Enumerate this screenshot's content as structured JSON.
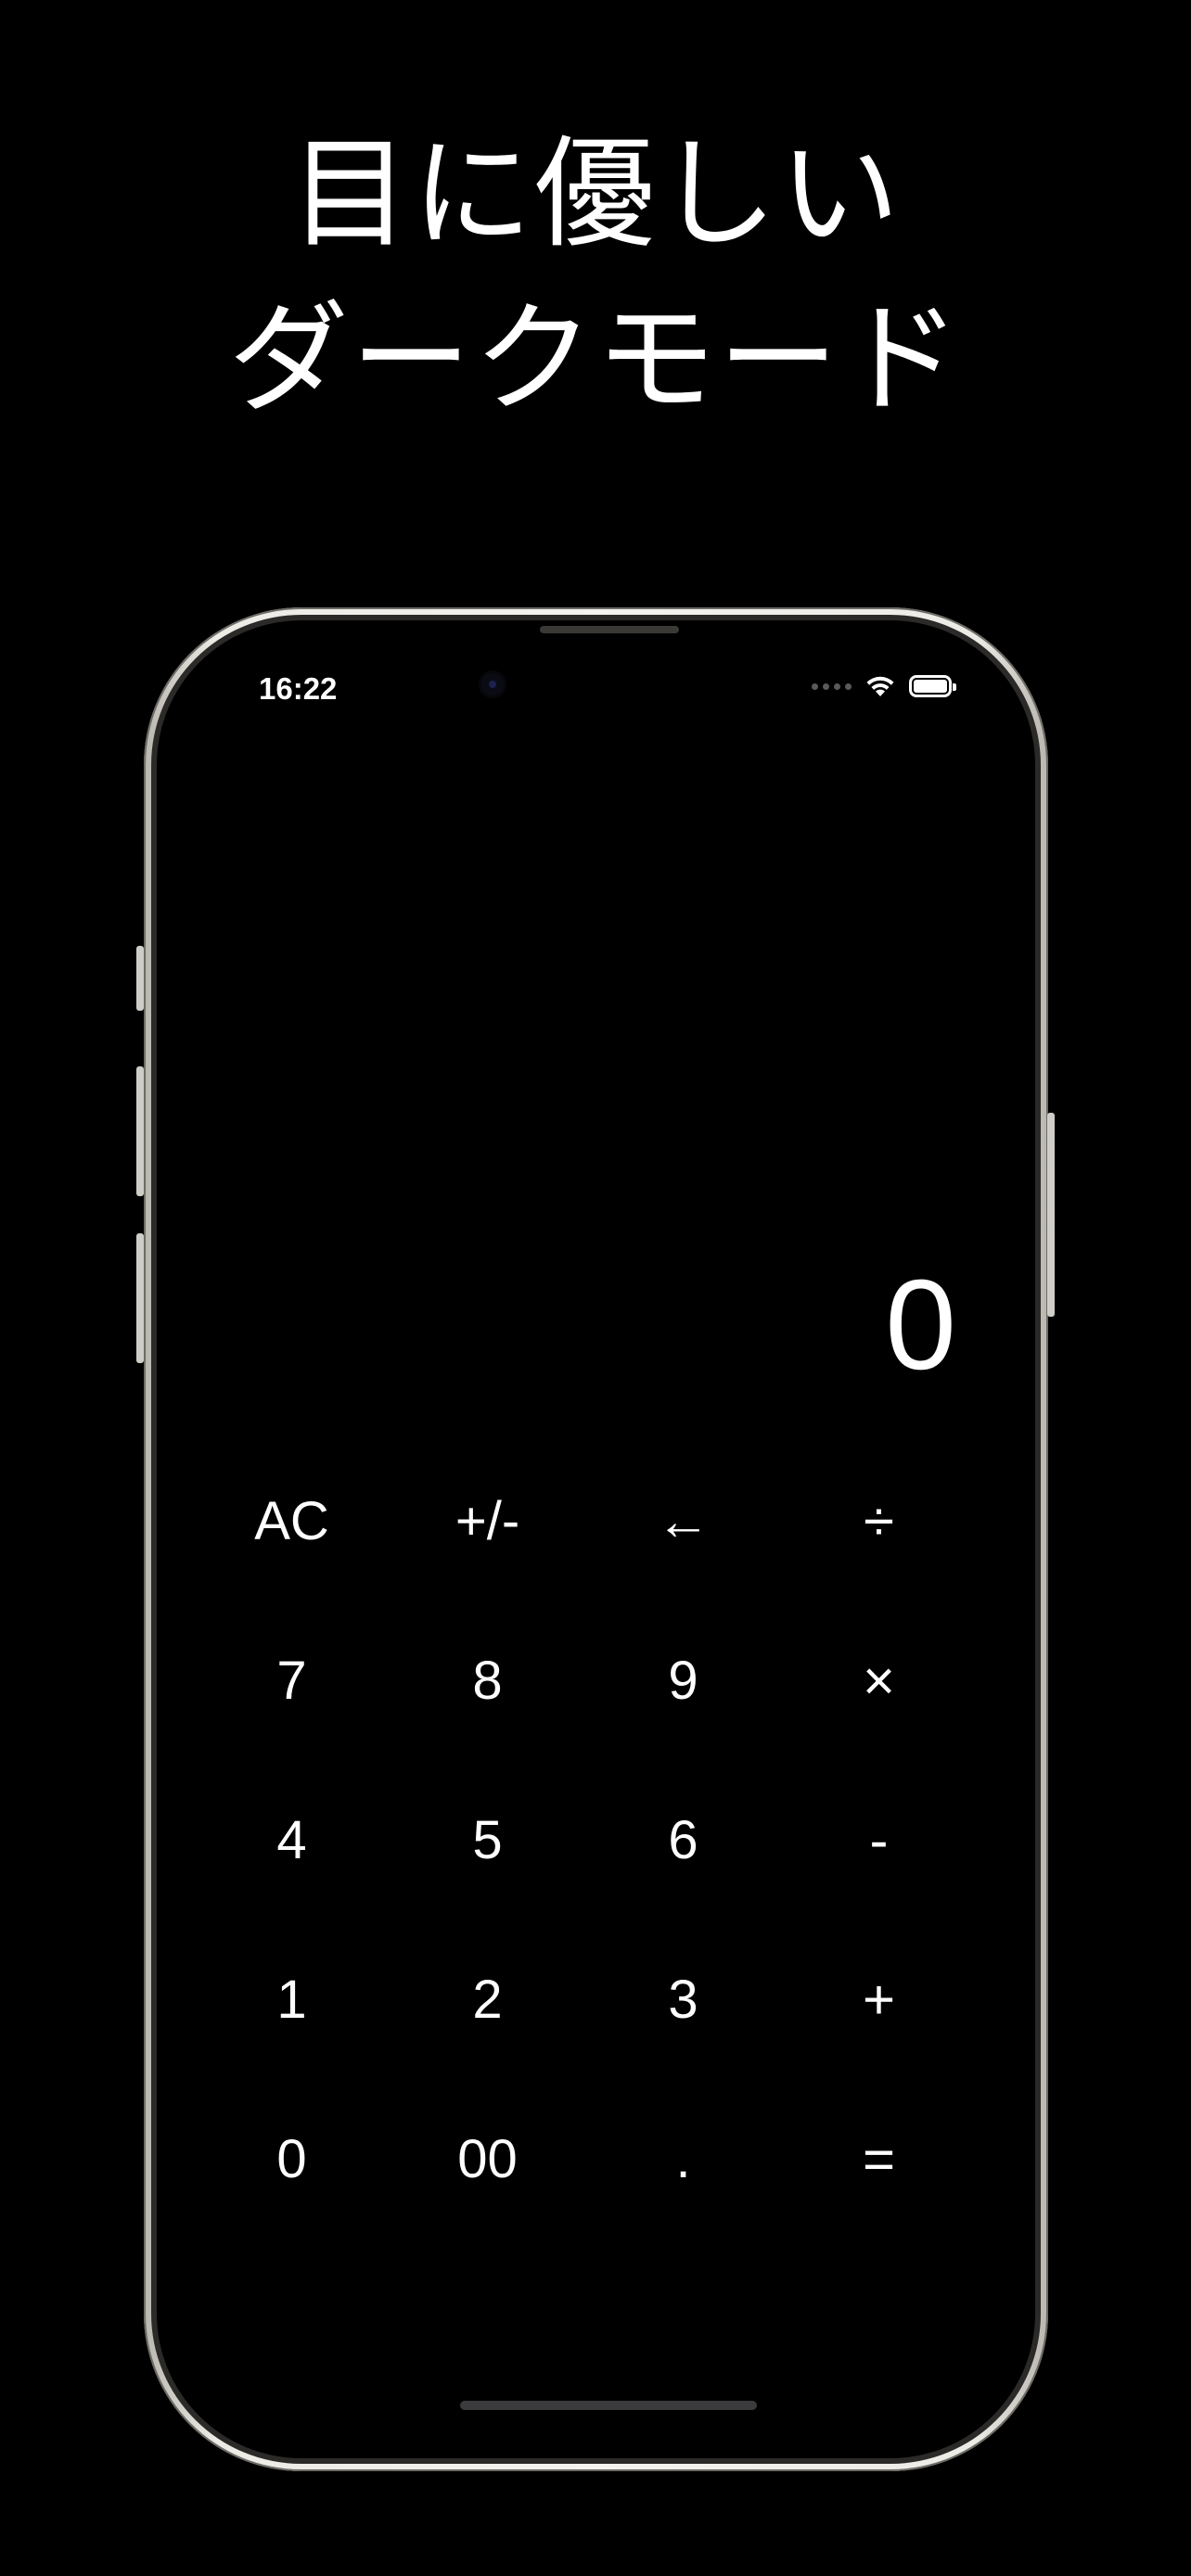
{
  "promo": {
    "headline_line1": "目に優しい",
    "headline_line2": "ダークモード"
  },
  "status_bar": {
    "time": "16:22",
    "icons": [
      "signal-dots-icon",
      "wifi-icon",
      "battery-icon"
    ]
  },
  "calculator": {
    "display_value": "0",
    "keys": [
      [
        "AC",
        "+/-",
        "←",
        "÷"
      ],
      [
        "7",
        "8",
        "9",
        "×"
      ],
      [
        "4",
        "5",
        "6",
        "-"
      ],
      [
        "1",
        "2",
        "3",
        "+"
      ],
      [
        "0",
        "00",
        ".",
        "="
      ]
    ]
  },
  "colors": {
    "background": "#000000",
    "text": "#ffffff",
    "frame": "#f0efea"
  }
}
